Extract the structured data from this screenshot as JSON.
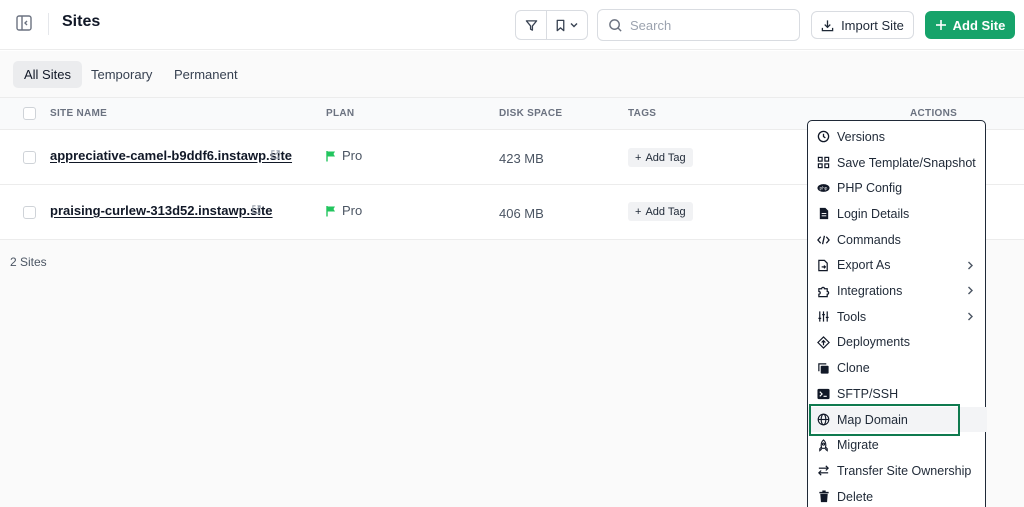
{
  "header": {
    "title": "Sites",
    "search_placeholder": "Search",
    "import_label": "Import Site",
    "add_label": "Add Site"
  },
  "tabs": [
    {
      "label": "All Sites",
      "active": true
    },
    {
      "label": "Temporary",
      "active": false
    },
    {
      "label": "Permanent",
      "active": false
    }
  ],
  "table": {
    "columns": [
      "SITE NAME",
      "PLAN",
      "DISK SPACE",
      "TAGS",
      "ACTIONS"
    ],
    "rows": [
      {
        "site": "appreciative-camel-b9ddf6.instawp.site",
        "plan": "Pro",
        "disk": "423 MB",
        "tag_label": "Add Tag"
      },
      {
        "site": "praising-curlew-313d52.instawp.site",
        "plan": "Pro",
        "disk": "406 MB",
        "tag_label": "Add Tag"
      }
    ],
    "count_label": "2 Sites"
  },
  "menu": {
    "items": [
      {
        "label": "Versions",
        "icon": "clock-icon"
      },
      {
        "label": "Save Template/Snapshot",
        "icon": "grid-icon"
      },
      {
        "label": "PHP Config",
        "icon": "php-icon"
      },
      {
        "label": "Login Details",
        "icon": "document-icon"
      },
      {
        "label": "Commands",
        "icon": "code-icon"
      },
      {
        "label": "Export As",
        "icon": "export-icon",
        "submenu": true
      },
      {
        "label": "Integrations",
        "icon": "puzzle-icon",
        "submenu": true
      },
      {
        "label": "Tools",
        "icon": "tools-icon",
        "submenu": true
      },
      {
        "label": "Deployments",
        "icon": "deploy-icon"
      },
      {
        "label": "Clone",
        "icon": "copy-icon"
      },
      {
        "label": "SFTP/SSH",
        "icon": "terminal-icon"
      },
      {
        "label": "Map Domain",
        "icon": "globe-icon",
        "highlighted": true
      },
      {
        "label": "Migrate",
        "icon": "rocket-icon"
      },
      {
        "label": "Transfer Site Ownership",
        "icon": "transfer-icon"
      },
      {
        "label": "Delete",
        "icon": "trash-icon"
      }
    ]
  },
  "colors": {
    "accent": "#16a36a",
    "highlight_border": "#0f7a4f",
    "plan_flag": "#22c55e"
  }
}
